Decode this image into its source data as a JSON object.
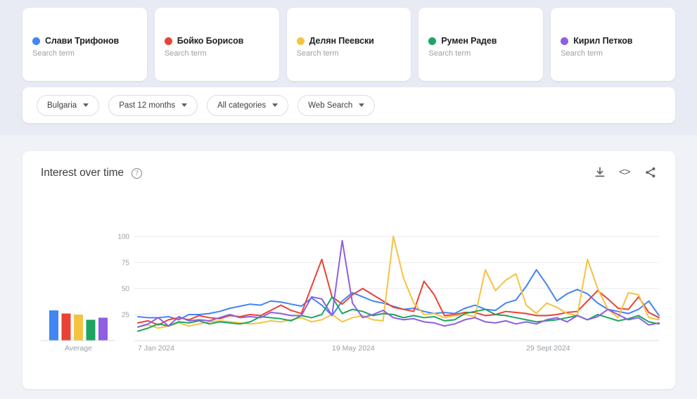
{
  "search_terms": [
    {
      "name": "Слави Трифонов",
      "type_label": "Search term",
      "color": "#4285F4"
    },
    {
      "name": "Бойко Борисов",
      "type_label": "Search term",
      "color": "#EA4335"
    },
    {
      "name": "Делян Пеевски",
      "type_label": "Search term",
      "color": "#F5C342"
    },
    {
      "name": "Румен Радев",
      "type_label": "Search term",
      "color": "#1DA462"
    },
    {
      "name": "Кирил Петков",
      "type_label": "Search term",
      "color": "#8E5FE0"
    }
  ],
  "filters": [
    {
      "label": "Bulgaria",
      "name": "region-filter"
    },
    {
      "label": "Past 12 months",
      "name": "time-range-filter"
    },
    {
      "label": "All categories",
      "name": "category-filter"
    },
    {
      "label": "Web Search",
      "name": "search-type-filter"
    }
  ],
  "chart_panel": {
    "title": "Interest over time",
    "help_glyph": "?",
    "embed_glyph": "<>",
    "average_label": "Average"
  },
  "chart_data": {
    "type": "line",
    "title": "Interest over time",
    "xlabel": "",
    "ylabel": "",
    "ylim": [
      0,
      100
    ],
    "yticks": [
      25,
      50,
      75,
      100
    ],
    "grid": true,
    "legend_position": "top-cards",
    "x_tick_labels": [
      "7 Jan 2024",
      "19 May 2024",
      "29 Sept 2024"
    ],
    "x_tick_indices": [
      0,
      19,
      38
    ],
    "x": [
      "7 Jan 2024",
      "14 Jan 2024",
      "21 Jan 2024",
      "28 Jan 2024",
      "4 Feb 2024",
      "11 Feb 2024",
      "18 Feb 2024",
      "25 Feb 2024",
      "3 Mar 2024",
      "10 Mar 2024",
      "17 Mar 2024",
      "24 Mar 2024",
      "31 Mar 2024",
      "7 Apr 2024",
      "14 Apr 2024",
      "21 Apr 2024",
      "28 Apr 2024",
      "5 May 2024",
      "12 May 2024",
      "19 May 2024",
      "26 May 2024",
      "2 Jun 2024",
      "9 Jun 2024",
      "16 Jun 2024",
      "23 Jun 2024",
      "30 Jun 2024",
      "7 Jul 2024",
      "14 Jul 2024",
      "21 Jul 2024",
      "28 Jul 2024",
      "4 Aug 2024",
      "11 Aug 2024",
      "18 Aug 2024",
      "25 Aug 2024",
      "1 Sept 2024",
      "8 Sept 2024",
      "15 Sept 2024",
      "22 Sept 2024",
      "29 Sept 2024",
      "6 Oct 2024",
      "13 Oct 2024",
      "20 Oct 2024",
      "27 Oct 2024",
      "3 Nov 2024",
      "10 Nov 2024",
      "17 Nov 2024",
      "24 Nov 2024",
      "1 Dec 2024",
      "8 Dec 2024",
      "15 Dec 2024",
      "22 Dec 2024",
      "29 Dec 2024"
    ],
    "series": [
      {
        "name": "Слави Трифонов",
        "color": "#4285F4",
        "average": 29,
        "values": [
          23,
          22,
          22,
          23,
          20,
          25,
          25,
          26,
          28,
          31,
          33,
          35,
          34,
          38,
          37,
          35,
          33,
          41,
          34,
          24,
          38,
          46,
          42,
          38,
          36,
          33,
          30,
          31,
          28,
          26,
          27,
          26,
          31,
          34,
          30,
          29,
          36,
          39,
          52,
          68,
          54,
          38,
          45,
          49,
          45,
          36,
          30,
          28,
          26,
          30,
          38,
          24
        ]
      },
      {
        "name": "Бойко Борисов",
        "color": "#EA4335",
        "average": 26,
        "values": [
          17,
          19,
          15,
          20,
          22,
          20,
          24,
          22,
          21,
          24,
          23,
          25,
          24,
          29,
          34,
          29,
          26,
          52,
          78,
          42,
          35,
          44,
          50,
          44,
          38,
          32,
          30,
          28,
          57,
          44,
          24,
          25,
          27,
          27,
          24,
          25,
          28,
          27,
          26,
          24,
          24,
          25,
          27,
          28,
          38,
          48,
          40,
          31,
          30,
          42,
          27,
          22
        ]
      },
      {
        "name": "Делян Пеевски",
        "color": "#F5C342",
        "average": 25,
        "values": [
          13,
          15,
          12,
          14,
          17,
          14,
          16,
          18,
          19,
          18,
          17,
          16,
          17,
          19,
          18,
          20,
          22,
          18,
          20,
          25,
          18,
          22,
          24,
          20,
          19,
          100,
          60,
          36,
          25,
          26,
          22,
          24,
          25,
          23,
          68,
          48,
          58,
          64,
          34,
          26,
          36,
          32,
          26,
          24,
          78,
          50,
          30,
          22,
          46,
          44,
          22,
          20
        ]
      },
      {
        "name": "Румен Радев",
        "color": "#1DA462",
        "average": 20,
        "values": [
          9,
          12,
          16,
          14,
          18,
          17,
          19,
          16,
          18,
          17,
          16,
          18,
          23,
          22,
          21,
          19,
          24,
          22,
          25,
          42,
          26,
          30,
          28,
          24,
          26,
          25,
          22,
          24,
          22,
          23,
          19,
          20,
          26,
          28,
          30,
          25,
          24,
          22,
          20,
          18,
          19,
          20,
          22,
          24,
          20,
          25,
          22,
          19,
          21,
          24,
          18,
          16
        ]
      },
      {
        "name": "Кирил Петков",
        "color": "#8E5FE0",
        "average": 22,
        "values": [
          13,
          16,
          22,
          14,
          23,
          19,
          20,
          19,
          22,
          25,
          22,
          23,
          22,
          27,
          26,
          24,
          24,
          42,
          40,
          24,
          96,
          36,
          22,
          25,
          29,
          22,
          20,
          21,
          18,
          17,
          14,
          16,
          20,
          22,
          18,
          17,
          19,
          16,
          18,
          16,
          20,
          22,
          18,
          24,
          20,
          23,
          30,
          25,
          20,
          22,
          15,
          17
        ]
      }
    ]
  }
}
